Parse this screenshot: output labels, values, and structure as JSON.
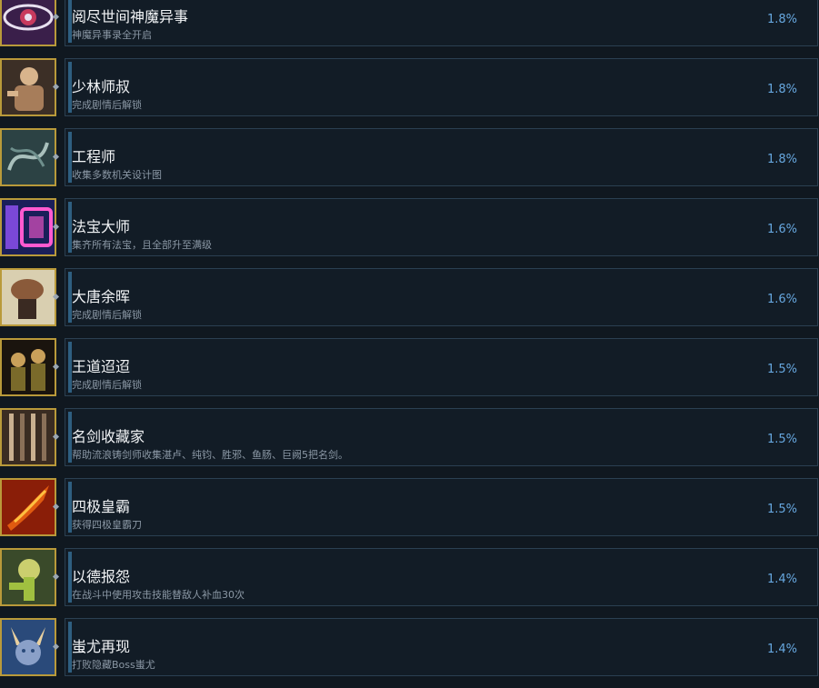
{
  "achievements": [
    {
      "title": "阅尽世间神魔异事",
      "description": "神魔异事录全开启",
      "percent": "1.8%",
      "icon": "eye-sigil-icon",
      "palette": [
        "#3a1f4a",
        "#c83a5e",
        "#e8e0f0"
      ]
    },
    {
      "title": "少林师叔",
      "description": "完成剧情后解锁",
      "percent": "1.8%",
      "icon": "monk-warrior-icon",
      "palette": [
        "#3c2f26",
        "#a77d5a",
        "#d8b48c"
      ]
    },
    {
      "title": "工程师",
      "description": "收集多数机关设计图",
      "percent": "1.8%",
      "icon": "blueprint-dragon-icon",
      "palette": [
        "#2c4244",
        "#6e8f8c",
        "#a9c0bc"
      ]
    },
    {
      "title": "法宝大师",
      "description": "集齐所有法宝，且全部升至满级",
      "percent": "1.6%",
      "icon": "treasure-full-icon",
      "palette": [
        "#1a1f5a",
        "#7a48d8",
        "#ff5ad0"
      ]
    },
    {
      "title": "大唐余晖",
      "description": "完成剧情后解锁",
      "percent": "1.6%",
      "icon": "straw-hat-traveler-icon",
      "palette": [
        "#d9cfb0",
        "#8a5a3a",
        "#3a2a22"
      ]
    },
    {
      "title": "王道迢迢",
      "description": "完成剧情后解锁",
      "percent": "1.5%",
      "icon": "two-figures-icon",
      "palette": [
        "#1a140e",
        "#7a6a2a",
        "#c9a05a"
      ]
    },
    {
      "title": "名剑收藏家",
      "description": "帮助流浪铸剑师收集湛卢、纯钧、胜邪、鱼肠、巨阙5把名剑。",
      "percent": "1.5%",
      "icon": "sword-rack-icon",
      "palette": [
        "#3a2c22",
        "#8a7058",
        "#c9b090"
      ]
    },
    {
      "title": "四极皇霸",
      "description": "获得四极皇霸刀",
      "percent": "1.5%",
      "icon": "flaming-blade-icon",
      "palette": [
        "#8a1e08",
        "#e05a10",
        "#ffc040"
      ]
    },
    {
      "title": "以德报怨",
      "description": "在战斗中使用攻击技能替敌人补血30次",
      "percent": "1.4%",
      "icon": "healing-strike-icon",
      "palette": [
        "#3a4a2a",
        "#a0c040",
        "#f0f080"
      ]
    },
    {
      "title": "蚩尤再现",
      "description": "打败隐藏Boss蚩尤",
      "percent": "1.4%",
      "icon": "horned-demon-icon",
      "palette": [
        "#2a4a7a",
        "#8aa0c8",
        "#e8d0a0"
      ]
    }
  ]
}
